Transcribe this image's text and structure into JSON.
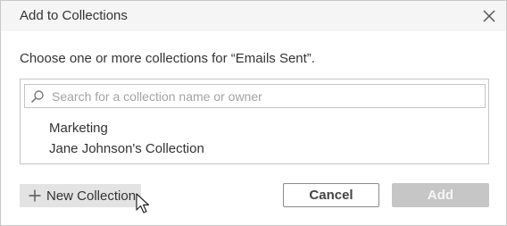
{
  "dialog": {
    "title": "Add to Collections",
    "prompt": "Choose one or more collections for “Emails Sent”."
  },
  "search": {
    "placeholder": "Search for a collection name or owner",
    "value": ""
  },
  "collections": [
    {
      "label": "Marketing"
    },
    {
      "label": "Jane Johnson's Collection"
    }
  ],
  "footer": {
    "new_collection_label": "New Collection",
    "cancel_label": "Cancel",
    "add_label": "Add",
    "add_enabled": false
  },
  "icons": {
    "close": "close-icon",
    "search": "search-icon",
    "plus": "plus-icon",
    "cursor": "mouse-cursor-icon"
  },
  "colors": {
    "disabled_button": "#c6c6c6",
    "secondary_button": "#e3e3e3",
    "text": "#333333"
  }
}
